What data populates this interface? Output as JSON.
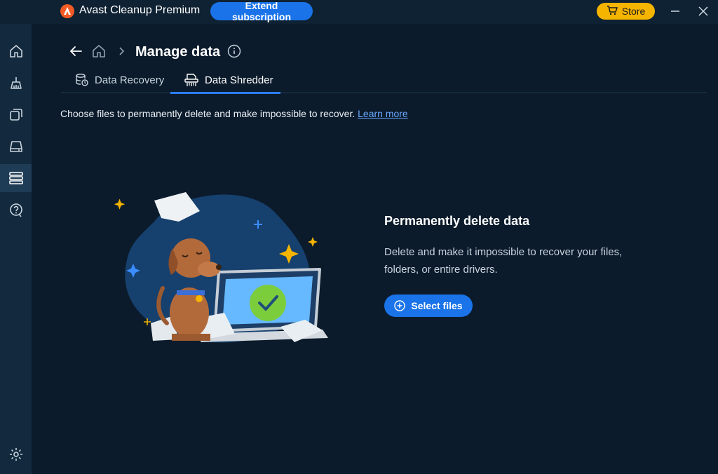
{
  "app": {
    "title": "Avast Cleanup Premium",
    "extend_label": "Extend subscription",
    "store_label": "Store"
  },
  "sidebar": {
    "items": [
      {
        "icon": "home-icon"
      },
      {
        "icon": "broom-icon"
      },
      {
        "icon": "layers-icon"
      },
      {
        "icon": "drive-icon"
      },
      {
        "icon": "data-icon",
        "active": true
      },
      {
        "icon": "help-icon"
      }
    ],
    "settings_icon": "gear-icon"
  },
  "header": {
    "page_title": "Manage data",
    "tabs": [
      {
        "label": "Data Recovery",
        "icon": "database-clock-icon",
        "active": false
      },
      {
        "label": "Data Shredder",
        "icon": "shredder-icon",
        "active": true
      }
    ]
  },
  "content": {
    "description": "Choose files to permanently delete and make impossible to recover.",
    "learn_more": "Learn more",
    "heading": "Permanently delete data",
    "paragraph": "Delete and make it impossible to recover your files, folders, or entire drivers.",
    "button_label": "Select files"
  },
  "colors": {
    "background": "#0b1b2b",
    "accent": "#1a73e8",
    "store": "#f5b400",
    "brand": "#f15a24"
  }
}
